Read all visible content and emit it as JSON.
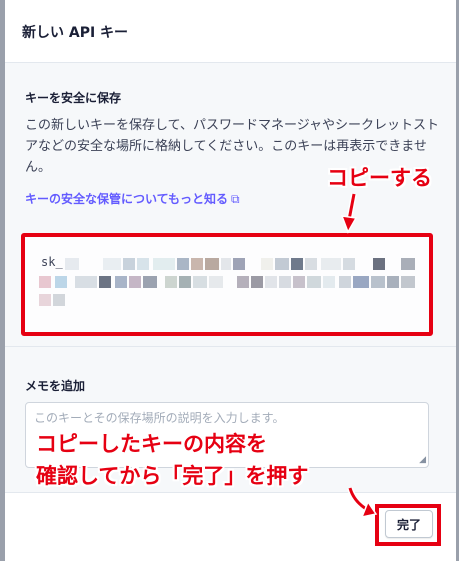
{
  "modal": {
    "title": "新しい API キー",
    "save_section": {
      "heading": "キーを安全に保存",
      "description": "この新しいキーを保存して、パスワードマネージャやシークレットストアなどの安全な場所に格納してください。このキーは再表示できません。",
      "learn_more_link": "キーの安全な保管についてもっと知る"
    },
    "api_key": {
      "prefix": "sk_"
    },
    "memo_section": {
      "heading": "メモを追加",
      "placeholder": "このキーとその保存場所の説明を入力します。"
    },
    "footer": {
      "done_label": "完了"
    }
  },
  "annotations": {
    "copy_label": "コピーする",
    "confirm_line1": "コピーしたキーの内容を",
    "confirm_line2": "確認してから「完了」を押す",
    "highlight_color": "#e60012"
  },
  "icons": {
    "external_link": "external-link-icon",
    "resize_grip": "resize-grip-icon"
  },
  "colors": {
    "link": "#635bff",
    "section_bg": "#f6f8fa",
    "annotation_red": "#e60012"
  }
}
